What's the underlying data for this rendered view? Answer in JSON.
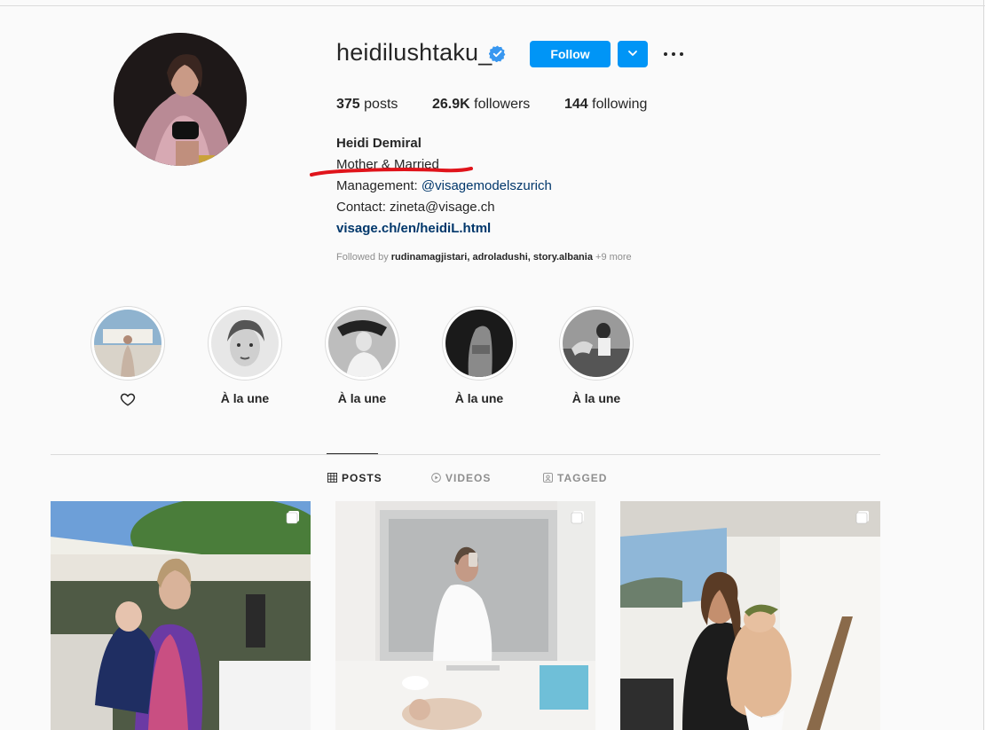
{
  "profile": {
    "username": "heidilushtaku_",
    "follow_label": "Follow",
    "stats": {
      "posts_count": "375",
      "posts_label": "posts",
      "followers_count": "26.9K",
      "followers_label": "followers",
      "following_count": "144",
      "following_label": "following"
    },
    "full_name": "Heidi Demiral",
    "bio_line1": "Mother & Married",
    "bio_management_prefix": "Management:",
    "bio_management_mention": "@visagemodelszurich",
    "bio_contact": "Contact: zineta@visage.ch",
    "website": "visage.ch/en/heidiL.html",
    "followed_by_prefix": "Followed by",
    "followed_by_users": "rudinamagjistari, adroladushi, story.albania",
    "followed_by_more": "+9 more"
  },
  "highlights": [
    {
      "label": "",
      "icon": "heart-icon"
    },
    {
      "label": "À la une"
    },
    {
      "label": "À la une"
    },
    {
      "label": "À la une"
    },
    {
      "label": "À la une"
    }
  ],
  "tabs": [
    {
      "label": "POSTS",
      "icon": "grid-icon",
      "active": true
    },
    {
      "label": "VIDEOS",
      "icon": "play-circle-icon",
      "active": false
    },
    {
      "label": "TAGGED",
      "icon": "tagged-icon",
      "active": false
    }
  ],
  "colors": {
    "accent": "#0095f6",
    "annotation_red": "#e0141b",
    "link": "#00376b"
  }
}
